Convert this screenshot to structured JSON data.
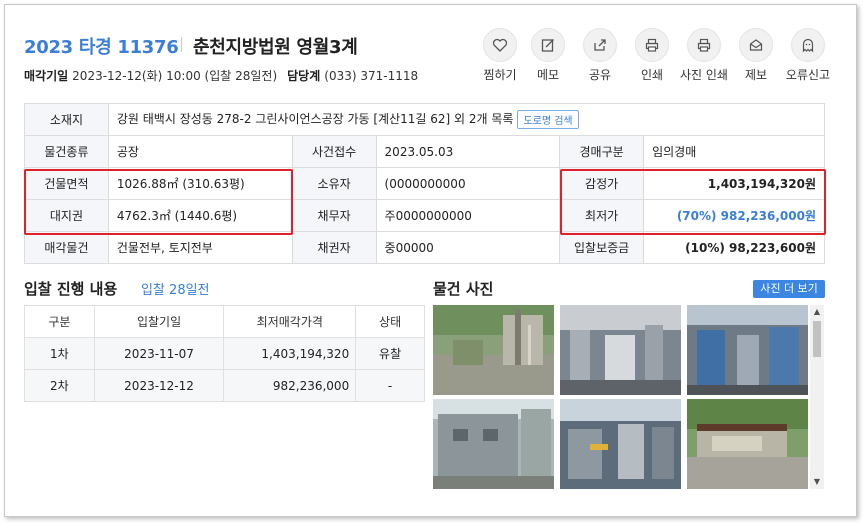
{
  "header": {
    "case_no": "2023 타경 11376",
    "court": "춘천지방법원 영월3계",
    "sale_date_label": "매각기일",
    "sale_date_value": "2023-12-12(화) 10:00 (입찰 28일전)",
    "dept_label": "담당계",
    "dept_value": "(033) 371-1118"
  },
  "actions": [
    {
      "label": "찜하기",
      "icon": "heart-icon"
    },
    {
      "label": "메모",
      "icon": "memo-icon"
    },
    {
      "label": "공유",
      "icon": "share-icon"
    },
    {
      "label": "인쇄",
      "icon": "print-icon"
    },
    {
      "label": "사진 인쇄",
      "icon": "photo-print-icon"
    },
    {
      "label": "제보",
      "icon": "report-icon"
    },
    {
      "label": "오류신고",
      "icon": "error-report-icon"
    }
  ],
  "info": {
    "location_label": "소재지",
    "location_value": "강원 태백시 장성동 278-2 그린사이언스공장 가동 [계산11길 62] 외 2개 목록",
    "road_search_btn": "도로명 검색",
    "r2": {
      "l1": "물건종류",
      "v1": "공장",
      "l2": "사건접수",
      "v2": "2023.05.03",
      "l3": "경매구분",
      "v3": "임의경매"
    },
    "r3": {
      "l1": "건물면적",
      "v1": "1026.88㎡ (310.63평)",
      "l2": "소유자",
      "v2": "(0000000000",
      "l3": "감정가",
      "v3": "1,403,194,320원"
    },
    "r4": {
      "l1": "대지권",
      "v1": "4762.3㎡ (1440.6평)",
      "l2": "채무자",
      "v2": "주0000000000",
      "l3": "최저가",
      "v3": "(70%) 982,236,000원"
    },
    "r5": {
      "l1": "매각물건",
      "v1": "건물전부, 토지전부",
      "l2": "채권자",
      "v2": "중00000",
      "l3": "입찰보증금",
      "v3": "(10%) 98,223,600원"
    }
  },
  "bid_section": {
    "title": "입찰 진행 내용",
    "subtitle": "입찰 28일전",
    "columns": [
      "구분",
      "입찰기일",
      "최저매각가격",
      "상태"
    ],
    "rows": [
      {
        "round": "1차",
        "date": "2023-11-07",
        "price": "1,403,194,320",
        "status": "유찰"
      },
      {
        "round": "2차",
        "date": "2023-12-12",
        "price": "982,236,000",
        "status": "-"
      }
    ]
  },
  "photo_section": {
    "title": "물건 사진",
    "more_btn": "사진 더 보기"
  },
  "colors": {
    "accent": "#3a7ed6",
    "highlight_box": "#e0202a"
  }
}
